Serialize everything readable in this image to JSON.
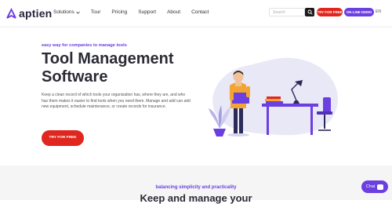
{
  "brand": {
    "name": "aptien",
    "accent": "#6b3fe0",
    "cta_color": "#e0261f"
  },
  "nav": {
    "items": [
      {
        "label": "Solutions",
        "has_dropdown": true
      },
      {
        "label": "Tour"
      },
      {
        "label": "Pricing"
      },
      {
        "label": "Support"
      },
      {
        "label": "About"
      },
      {
        "label": "Contact"
      }
    ]
  },
  "header": {
    "search_placeholder": "Search",
    "try_label": "TRY FOR FREE",
    "demo_label": "ON-LINE DEMO",
    "lang_label": "EN"
  },
  "hero": {
    "kicker": "easy way for companies to manage tools",
    "title_line1": "Tool Management",
    "title_line2": "Software",
    "description": "Keep a clean record of which tools your organization has, where they are, and who has them makes it easier to find tools when you need them. Manage and add can add new equipment, schedule maintenance, or create records for insurance.",
    "cta_label": "TRY FOR FREE"
  },
  "section2": {
    "kicker": "balancing simplicity and practicality",
    "title": "Keep and manage your"
  },
  "chat": {
    "label": "Chat"
  }
}
